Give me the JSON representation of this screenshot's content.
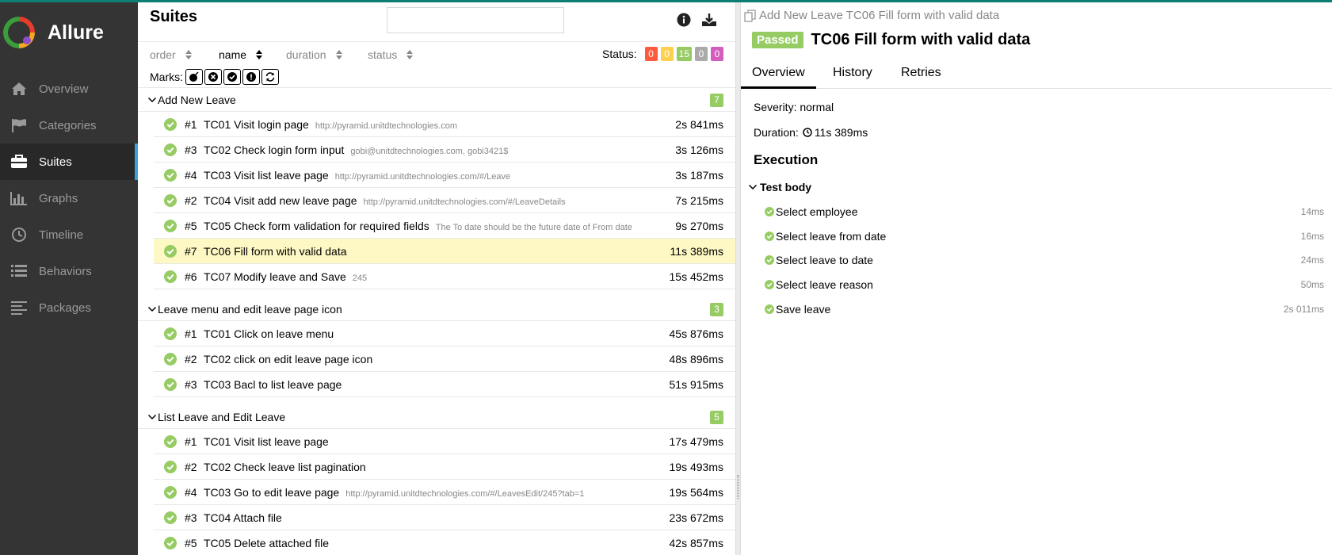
{
  "app": {
    "name": "Allure"
  },
  "sidebar": {
    "items": [
      {
        "label": "Overview",
        "icon": "home-icon"
      },
      {
        "label": "Categories",
        "icon": "flag-icon"
      },
      {
        "label": "Suites",
        "icon": "briefcase-icon",
        "active": true
      },
      {
        "label": "Graphs",
        "icon": "bar-chart-icon"
      },
      {
        "label": "Timeline",
        "icon": "clock-icon"
      },
      {
        "label": "Behaviors",
        "icon": "list-icon"
      },
      {
        "label": "Packages",
        "icon": "align-left-icon"
      }
    ]
  },
  "suites": {
    "title": "Suites",
    "search_value": "",
    "sort": {
      "order": "order",
      "name": "name",
      "duration": "duration",
      "status": "status"
    },
    "status_label": "Status:",
    "status_counts": {
      "failed": "0",
      "broken": "0",
      "passed": "15",
      "skipped": "0",
      "unknown": "0"
    },
    "marks_label": "Marks:",
    "groups": [
      {
        "name": "Add New Leave",
        "count": "7",
        "tests": [
          {
            "num": "#1",
            "name": "TC01 Visit login page",
            "param": "http://pyramid.unitdtechnologies.com",
            "duration": "2s 841ms"
          },
          {
            "num": "#3",
            "name": "TC02 Check login form input",
            "param": "gobi@unitdtechnologies.com, gobi3421$",
            "duration": "3s 126ms"
          },
          {
            "num": "#4",
            "name": "TC03 Visit list leave page",
            "param": "http://pyramid.unitdtechnologies.com/#/Leave",
            "duration": "3s 187ms"
          },
          {
            "num": "#2",
            "name": "TC04 Visit add new leave page",
            "param": "http://pyramid.unitdtechnologies.com/#/LeaveDetails",
            "duration": "7s 215ms"
          },
          {
            "num": "#5",
            "name": "TC05 Check form validation for required fields",
            "param": "The To date should be the future date of From date",
            "duration": "9s 270ms"
          },
          {
            "num": "#7",
            "name": "TC06 Fill form with valid data",
            "param": "",
            "duration": "11s 389ms"
          },
          {
            "num": "#6",
            "name": "TC07 Modify leave and Save",
            "param": "245",
            "duration": "15s 452ms"
          }
        ]
      },
      {
        "name": "Leave menu and edit leave page icon",
        "count": "3",
        "tests": [
          {
            "num": "#1",
            "name": "TC01 Click on leave menu",
            "param": "",
            "duration": "45s 876ms"
          },
          {
            "num": "#2",
            "name": "TC02 click on edit leave page icon",
            "param": "",
            "duration": "48s 896ms"
          },
          {
            "num": "#3",
            "name": "TC03 Bacl to list leave page",
            "param": "",
            "duration": "51s 915ms"
          }
        ]
      },
      {
        "name": "List Leave and Edit Leave",
        "count": "5",
        "tests": [
          {
            "num": "#1",
            "name": "TC01 Visit list leave page",
            "param": "",
            "duration": "17s 479ms"
          },
          {
            "num": "#2",
            "name": "TC02 Check leave list pagination",
            "param": "",
            "duration": "19s 493ms"
          },
          {
            "num": "#4",
            "name": "TC03 Go to edit leave page",
            "param": "http://pyramid.unitdtechnologies.com/#/LeavesEdit/245?tab=1",
            "duration": "19s 564ms"
          },
          {
            "num": "#3",
            "name": "TC04 Attach file",
            "param": "",
            "duration": "23s 672ms"
          },
          {
            "num": "#5",
            "name": "TC05 Delete attached file",
            "param": "",
            "duration": "42s 857ms"
          }
        ]
      }
    ]
  },
  "detail": {
    "breadcrumb": "Add New Leave TC06 Fill form with valid data",
    "status_badge": "Passed",
    "title": "TC06 Fill form with valid data",
    "tabs": [
      "Overview",
      "History",
      "Retries"
    ],
    "severity": "Severity: normal",
    "duration_label": "Duration:",
    "duration_value": "11s 389ms",
    "execution_title": "Execution",
    "test_body_label": "Test body",
    "steps": [
      {
        "name": "Select employee",
        "duration": "14ms"
      },
      {
        "name": "Select leave from date",
        "duration": "16ms"
      },
      {
        "name": "Select leave to date",
        "duration": "24ms"
      },
      {
        "name": "Select leave reason",
        "duration": "50ms"
      },
      {
        "name": "Save leave",
        "duration": "2s 011ms"
      }
    ]
  },
  "colors": {
    "sidebar_bg": "#343434",
    "accent_active": "#3ea0d8",
    "passed": "#97cc64",
    "failed": "#fd5a3e",
    "broken": "#ffd050",
    "skipped": "#aaaaaa",
    "unknown": "#d35ebe",
    "selected_row": "#fdf8c4"
  }
}
